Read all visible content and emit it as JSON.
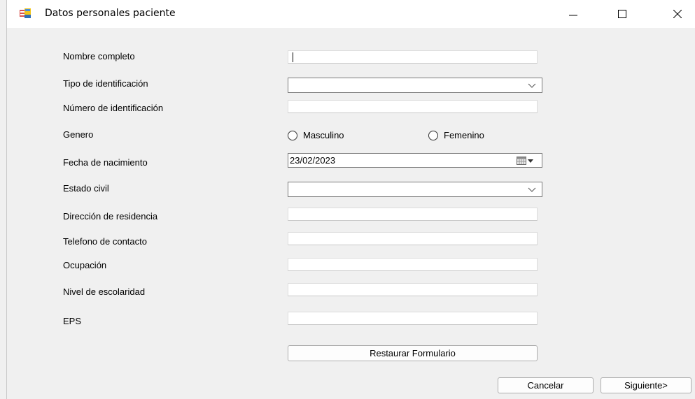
{
  "window": {
    "title": "Datos personales paciente",
    "icons": {
      "app": "form-app-icon",
      "minimize": "minimize-icon",
      "maximize": "maximize-icon",
      "close": "close-icon"
    }
  },
  "form": {
    "labels": {
      "nombre": "Nombre completo",
      "tipo_id": "Tipo de identificación",
      "numero_id": "Número de identificación",
      "genero": "Genero",
      "fecha": "Fecha de nacimiento",
      "estado_civil": "Estado civil",
      "direccion": "Dirección de residencia",
      "telefono": "Telefono de contacto",
      "ocupacion": "Ocupación",
      "escolaridad": "Nivel de escolaridad",
      "eps": "EPS"
    },
    "values": {
      "nombre": "",
      "tipo_id": "",
      "numero_id": "",
      "fecha": "23/02/2023",
      "estado_civil": "",
      "direccion": "",
      "telefono": "",
      "ocupacion": "",
      "escolaridad": "",
      "eps": ""
    },
    "genero_options": {
      "masculino": "Masculino",
      "femenino": "Femenino"
    },
    "buttons": {
      "restaurar": "Restaurar Formulario",
      "cancelar": "Cancelar",
      "siguiente": "Siguiente>"
    }
  },
  "colors": {
    "window_bg": "#f0f0f0",
    "titlebar_bg": "#ffffff",
    "border": "#7a7a7a"
  }
}
